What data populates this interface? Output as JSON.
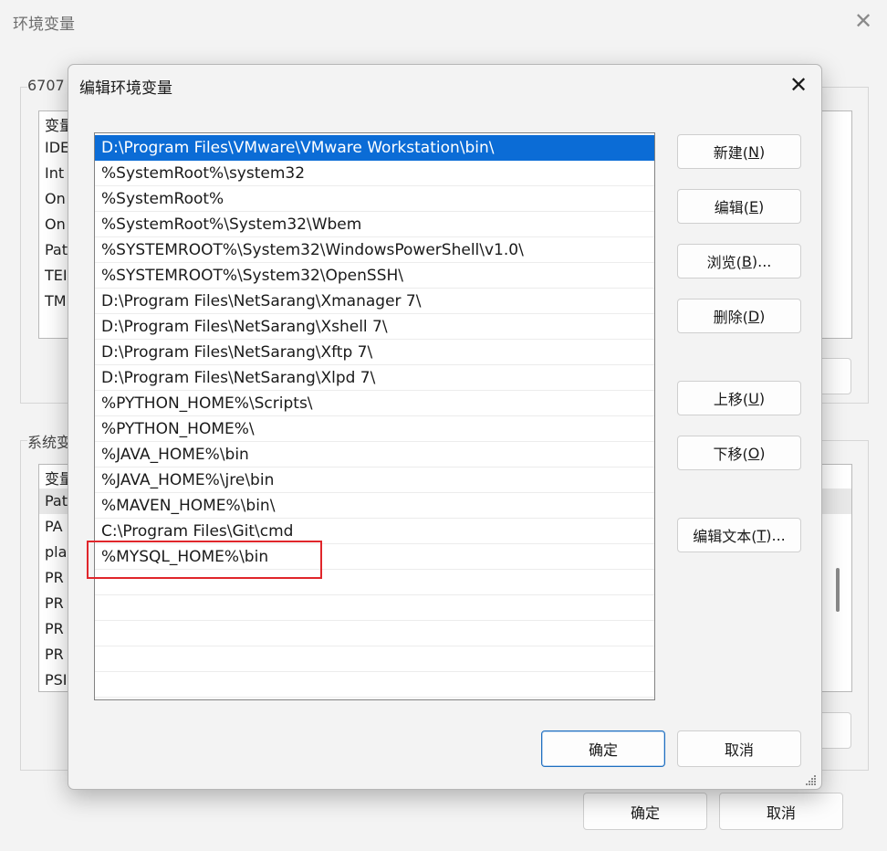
{
  "background_window": {
    "title": "环境变量",
    "user_group_label": "6707",
    "user_vars_header": "变量",
    "user_vars": [
      "IDE",
      "Int",
      "On",
      "On",
      "Pat",
      "TEI",
      "TM"
    ],
    "system_group_label": "系统变",
    "system_vars_header": "变量",
    "system_vars": [
      "Pat",
      "PA",
      "pla",
      "PR",
      "PR",
      "PR",
      "PR",
      "PSI"
    ],
    "ok_label": "确定",
    "cancel_label": "取消"
  },
  "dialog": {
    "title": "编辑环境变量",
    "entries": [
      "D:\\Program Files\\VMware\\VMware Workstation\\bin\\",
      "%SystemRoot%\\system32",
      "%SystemRoot%",
      "%SystemRoot%\\System32\\Wbem",
      "%SYSTEMROOT%\\System32\\WindowsPowerShell\\v1.0\\",
      "%SYSTEMROOT%\\System32\\OpenSSH\\",
      "D:\\Program Files\\NetSarang\\Xmanager 7\\",
      "D:\\Program Files\\NetSarang\\Xshell 7\\",
      "D:\\Program Files\\NetSarang\\Xftp 7\\",
      "D:\\Program Files\\NetSarang\\Xlpd 7\\",
      "%PYTHON_HOME%\\Scripts\\",
      "%PYTHON_HOME%\\",
      "%JAVA_HOME%\\bin",
      "%JAVA_HOME%\\jre\\bin",
      "%MAVEN_HOME%\\bin\\",
      "C:\\Program Files\\Git\\cmd",
      "%MYSQL_HOME%\\bin"
    ],
    "selected_index": 0,
    "highlighted_index": 16,
    "buttons": {
      "new": {
        "label": "新建(",
        "key": "N",
        "suffix": ")"
      },
      "edit": {
        "label": "编辑(",
        "key": "E",
        "suffix": ")"
      },
      "browse": {
        "label": "浏览(",
        "key": "B",
        "suffix": ")..."
      },
      "delete": {
        "label": "删除(",
        "key": "D",
        "suffix": ")"
      },
      "move_up": {
        "label": "上移(",
        "key": "U",
        "suffix": ")"
      },
      "move_down": {
        "label": "下移(",
        "key": "O",
        "suffix": ")"
      },
      "edit_text": {
        "label": "编辑文本(",
        "key": "T",
        "suffix": ")..."
      }
    },
    "ok_label": "确定",
    "cancel_label": "取消"
  },
  "colors": {
    "selection": "#0b6cd6",
    "highlight_box": "#e0262b"
  }
}
